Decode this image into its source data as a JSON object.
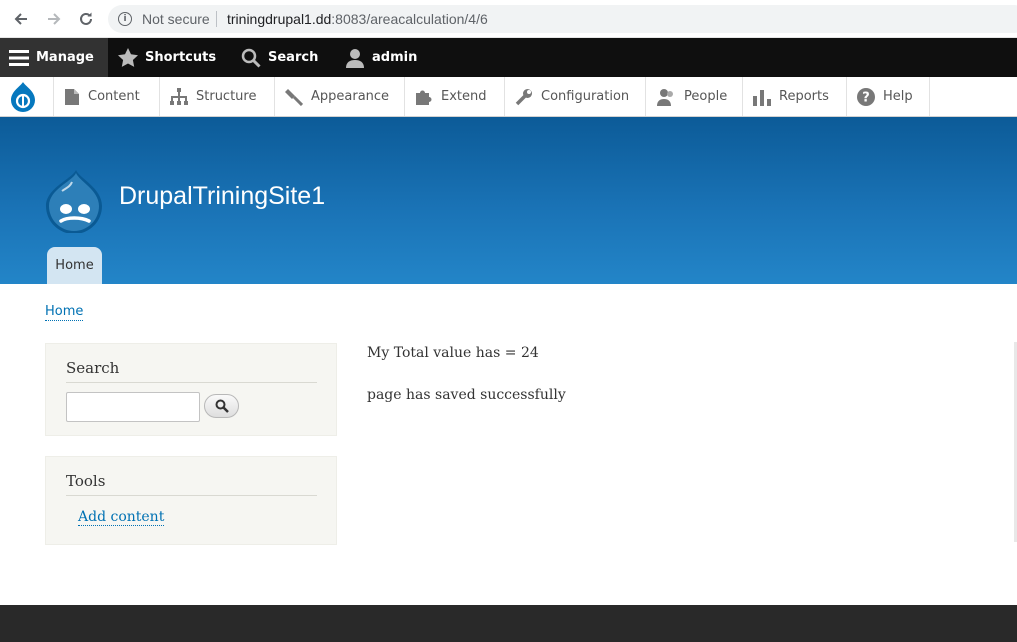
{
  "browser": {
    "security_label": "Not secure",
    "url_host": "triningdrupal1.dd",
    "url_path": ":8083/areacalculation/4/6"
  },
  "toolbar": {
    "manage": "Manage",
    "shortcuts": "Shortcuts",
    "search": "Search",
    "user": "admin"
  },
  "tray": {
    "items": [
      {
        "label": "Content",
        "icon": "content-icon"
      },
      {
        "label": "Structure",
        "icon": "structure-icon"
      },
      {
        "label": "Appearance",
        "icon": "appearance-icon"
      },
      {
        "label": "Extend",
        "icon": "extend-icon"
      },
      {
        "label": "Configuration",
        "icon": "configuration-icon"
      },
      {
        "label": "People",
        "icon": "people-icon"
      },
      {
        "label": "Reports",
        "icon": "reports-icon"
      },
      {
        "label": "Help",
        "icon": "help-icon"
      }
    ]
  },
  "header": {
    "site_name": "DrupalTriningSite1",
    "tab_home": "Home"
  },
  "breadcrumb": {
    "home": "Home"
  },
  "sidebar": {
    "search_title": "Search",
    "search_value": "",
    "tools_title": "Tools",
    "add_content": "Add content"
  },
  "main": {
    "line1": "My Total value has = 24",
    "line2": "page has saved successfully"
  },
  "colors": {
    "header_top": "#0c5b98",
    "header_bottom": "#2385c8",
    "link": "#0071b3",
    "toolbar_bg": "#0f0f0f"
  }
}
